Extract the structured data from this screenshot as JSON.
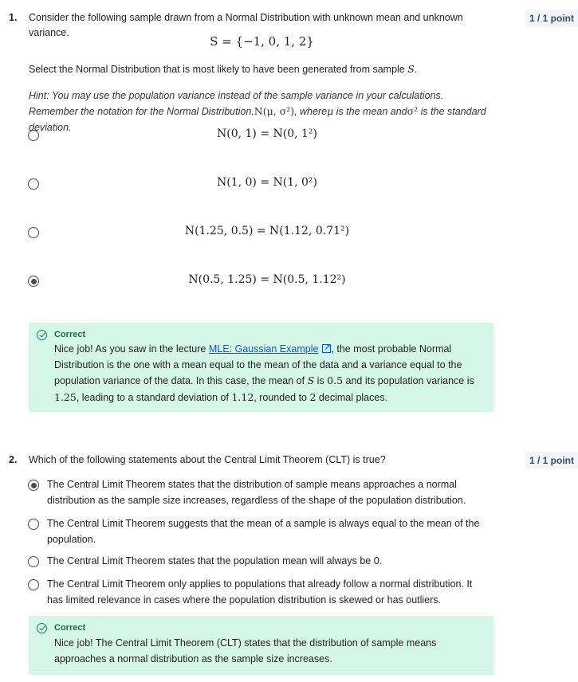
{
  "q1": {
    "number": "1.",
    "points": "1 / 1 point",
    "prompt": "Consider the following sample drawn from a Normal Distribution with unknown mean and unknown variance.",
    "sample": "S = {−1, 0, 1, 2}",
    "instruction_pre": "Select the Normal Distribution that is most likely to have been generated from sample ",
    "instruction_var": "S",
    "instruction_post": ".",
    "hint_a": "Hint: You may use the population variance instead of the sample variance in your calculations. Remember the notation for the Normal Distribution.",
    "hint_math": "N(μ, σ²)",
    "hint_b": ", where",
    "hint_mu": "μ",
    "hint_c": " is the mean and",
    "hint_sigma": "σ²",
    "hint_d": " is the standard deviation.",
    "options": [
      {
        "text": "N(0, 1) = N(0, 1²)",
        "selected": false
      },
      {
        "text": "N(1, 0) = N(1, 0²)",
        "selected": false
      },
      {
        "text": "N(1.25, 0.5) = N(1.12, 0.71²)",
        "selected": false
      },
      {
        "text": "N(0.5, 1.25) = N(0.5, 1.12²)",
        "selected": true
      }
    ],
    "feedback": {
      "title": "Correct",
      "p1": "Nice job! As you saw in the lecture ",
      "link": "MLE: Gaussian Example",
      "p2": ", the most probable Normal Distribution is the one with a mean equal to the mean of the data and a variance equal to the population variance of the data. In this case, the mean of ",
      "s": "S",
      "p3": " is ",
      "mean": "0.5",
      "p4": " and its population variance is ",
      "var": "1.25",
      "p5": ", leading to a standard deviation of ",
      "sd": "1.12",
      "p6": ", rounded to ",
      "dp": "2",
      "p7": " decimal places."
    }
  },
  "q2": {
    "number": "2.",
    "points": "1 / 1 point",
    "prompt": "Which of the following statements about the Central Limit Theorem (CLT) is true?",
    "options": [
      {
        "text": "The Central Limit Theorem states that the distribution of sample means approaches a normal distribution as the sample size increases, regardless of the shape of the population distribution.",
        "selected": true
      },
      {
        "text": "The Central Limit Theorem suggests that the mean of a sample is always equal to the mean of the population.",
        "selected": false
      },
      {
        "text": "The Central Limit Theorem states that the population mean will always be 0.",
        "selected": false
      },
      {
        "text": "The Central Limit Theorem only applies to populations that already follow a normal distribution. It has limited relevance in cases where the population distribution is skewed or has outliers.",
        "selected": false
      }
    ],
    "feedback": {
      "title": "Correct",
      "text": "Nice job! The Central Limit Theorem (CLT) states that the distribution of sample means approaches a normal distribution as the sample size increases."
    }
  }
}
